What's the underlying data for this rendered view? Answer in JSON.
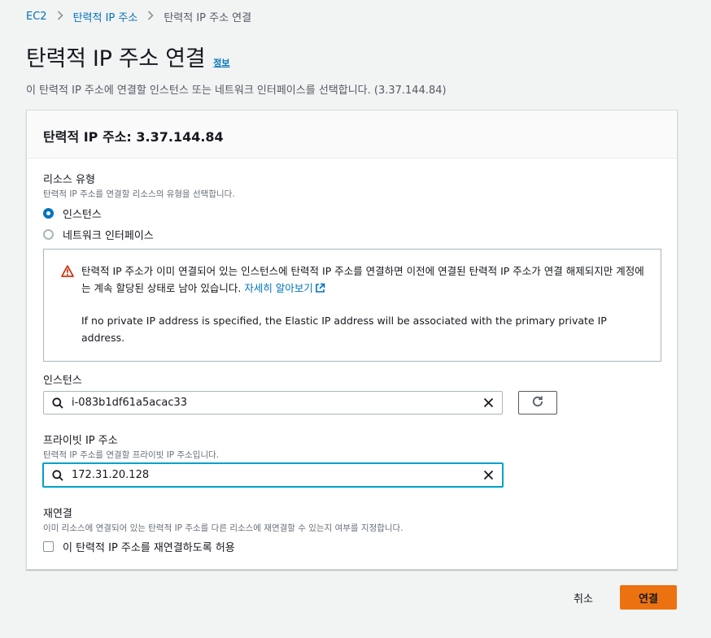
{
  "breadcrumb": {
    "items": [
      "EC2",
      "탄력적 IP 주소"
    ],
    "current": "탄력적 IP 주소 연결"
  },
  "page": {
    "title": "탄력적 IP 주소 연결",
    "info_link": "정보",
    "description": "이 탄력적 IP 주소에 연결할 인스턴스 또는 네트워크 인터페이스를 선택합니다. (3.37.144.84)"
  },
  "panel": {
    "header": "탄력적 IP 주소: 3.37.144.84",
    "resource_type": {
      "label": "리소스 유형",
      "help": "탄력적 IP 주소를 연결할 리소스의 유형을 선택합니다.",
      "options": [
        "인스턴스",
        "네트워크 인터페이스"
      ],
      "selected": "인스턴스"
    },
    "alert": {
      "text": "탄력적 IP 주소가 이미 연결되어 있는 인스턴스에 탄력적 IP 주소를 연결하면 이전에 연결된 탄력적 IP 주소가 연결 해제되지만 계정에는 계속 할당된 상태로 남아 있습니다.",
      "link": "자세히 알아보기",
      "note": "If no private IP address is specified, the Elastic IP address will be associated with the primary private IP address."
    },
    "instance": {
      "label": "인스턴스",
      "value": "i-083b1df61a5acac33"
    },
    "private_ip": {
      "label": "프라이빗 IP 주소",
      "help": "탄력적 IP 주소를 연결할 프라이빗 IP 주소입니다.",
      "value": "172.31.20.128"
    },
    "reassociation": {
      "label": "재연결",
      "help": "이미 리소스에 연결되어 있는 탄력적 IP 주소를 다른 리소스에 재연결할 수 있는지 여부를 지정합니다.",
      "checkbox_label": "이 탄력적 IP 주소를 재연결하도록 허용",
      "checked": false
    }
  },
  "actions": {
    "cancel": "취소",
    "submit": "연결"
  },
  "colors": {
    "link": "#0073bb",
    "primary": "#ec7211",
    "warning": "#d13212",
    "focus": "#00a1c9"
  }
}
